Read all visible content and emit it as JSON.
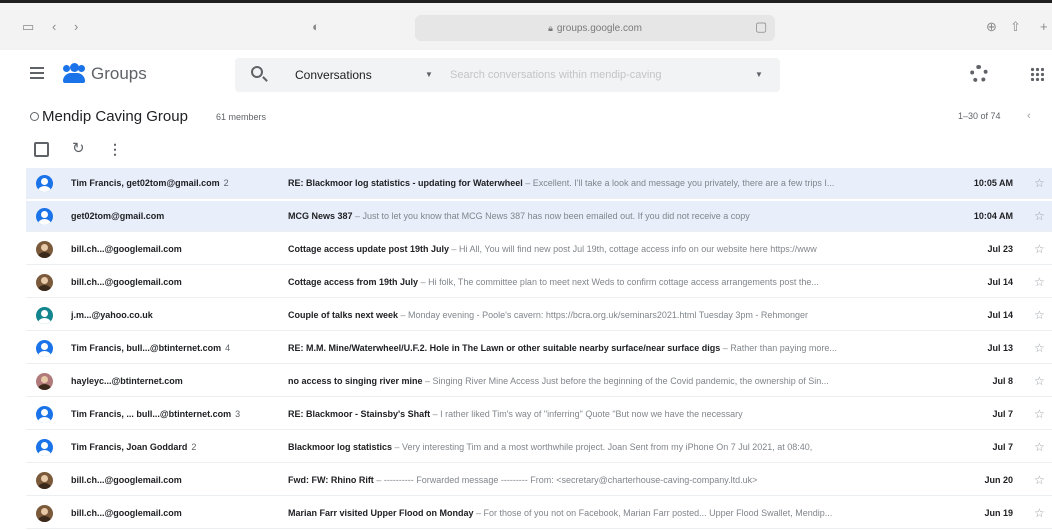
{
  "browser": {
    "url": "groups.google.com"
  },
  "header": {
    "app_name": "Groups",
    "search_scope": "Conversations",
    "search_placeholder": "Search conversations within mendip-caving"
  },
  "group": {
    "name": "Mendip Caving Group",
    "members": "61 members",
    "pagination": "1–30 of 74"
  },
  "conversations": [
    {
      "sender": "Tim Francis, get02tom@gmail.com",
      "count": "2",
      "subject": "RE: Blackmoor log statistics - updating for Waterwheel",
      "snippet": " – Excellent. I'll take a look and message you privately, there are a few trips I...",
      "date": "10:05 AM",
      "avatar": "blue",
      "highlight": true
    },
    {
      "sender": "get02tom@gmail.com",
      "count": "",
      "subject": "MCG News 387",
      "snippet": " – Just to let you know that MCG News 387 has now been emailed out. If you did not receive a copy",
      "date": "10:04 AM",
      "avatar": "blue",
      "highlight": true
    },
    {
      "sender": "bill.ch...@googlemail.com",
      "count": "",
      "subject": "Cottage access update post 19th July",
      "snippet": " – Hi All, You will find new post Jul 19th, cottage access info on our website here https://www",
      "date": "Jul 23",
      "avatar": "photo",
      "highlight": false
    },
    {
      "sender": "bill.ch...@googlemail.com",
      "count": "",
      "subject": "Cottage access from 19th July",
      "snippet": " – Hi folk, The committee plan to meet next Weds to confirm cottage access arrangements post the...",
      "date": "Jul 14",
      "avatar": "photo",
      "highlight": false
    },
    {
      "sender": "j.m...@yahoo.co.uk",
      "count": "",
      "subject": "Couple of talks next week",
      "snippet": " – Monday evening - Poole's cavern: https://bcra.org.uk/seminars2021.html Tuesday 3pm - Rehmonger",
      "date": "Jul 14",
      "avatar": "teal",
      "highlight": false
    },
    {
      "sender": "Tim Francis, bull...@btinternet.com",
      "count": "4",
      "subject": "RE: M.M. Mine/Waterwheel/U.F.2. Hole in The Lawn or other suitable nearby surface/near surface digs",
      "snippet": " – Rather than paying more...",
      "date": "Jul 13",
      "avatar": "blue",
      "highlight": false
    },
    {
      "sender": "hayleyc...@btinternet.com",
      "count": "",
      "subject": "no access to singing river mine",
      "snippet": " – Singing River Mine Access Just before the beginning of the Covid pandemic, the ownership of Sin...",
      "date": "Jul 8",
      "avatar": "pink",
      "highlight": false
    },
    {
      "sender": "Tim Francis, ... bull...@btinternet.com",
      "count": "3",
      "subject": "RE: Blackmoor - Stainsby's Shaft",
      "snippet": " – I rather liked Tim's way of \"inferring\" Quote \"But now we have the necessary",
      "date": "Jul 7",
      "avatar": "blue",
      "highlight": false
    },
    {
      "sender": "Tim Francis, Joan Goddard",
      "count": "2",
      "subject": "Blackmoor log statistics",
      "snippet": " – Very interesting Tim and a most worthwhile project. Joan Sent from my iPhone On 7 Jul 2021, at 08:40,",
      "date": "Jul 7",
      "avatar": "blue",
      "highlight": false
    },
    {
      "sender": "bill.ch...@googlemail.com",
      "count": "",
      "subject": "Fwd: FW: Rhino Rift",
      "snippet": " – ---------- Forwarded message --------- From: <secretary@charterhouse-caving-company.ltd.uk>",
      "date": "Jun 20",
      "avatar": "photo",
      "highlight": false
    },
    {
      "sender": "bill.ch...@googlemail.com",
      "count": "",
      "subject": "Marian Farr visited Upper Flood on Monday",
      "snippet": " – For those of you not on Facebook, Marian Farr posted... Upper Flood Swallet, Mendip...",
      "date": "Jun 19",
      "avatar": "photo",
      "highlight": false
    }
  ]
}
